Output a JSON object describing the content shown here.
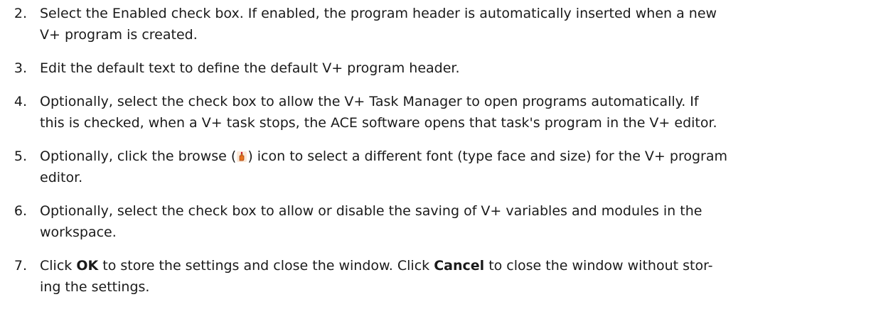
{
  "steps": [
    {
      "num": "2.",
      "line1": "Select the Enabled check box. If enabled, the program header is automatically inserted when a new",
      "line2": "V+ program is created."
    },
    {
      "num": "3.",
      "line1": "Edit the default text to define the default V+ program header."
    },
    {
      "num": "4.",
      "line1": "Optionally, select the check box to allow the V+ Task Manager to open programs automatically. If",
      "line2": "this is checked, when a V+ task stops, the ACE software opens that task's program in the V+ editor."
    },
    {
      "num": "5.",
      "line1_a": "Optionally, click the browse (",
      "line1_b": ") icon to select a different font (type face and size) for the V+ program",
      "line2": "editor.",
      "icon": "browse-hand-icon"
    },
    {
      "num": "6.",
      "line1": "Optionally, select the check box to allow or disable the saving of V+ variables and modules in the",
      "line2": "workspace."
    },
    {
      "num": "7.",
      "line1_a": "Click ",
      "ok": "OK",
      "line1_b": " to store the settings and close the window. Click ",
      "cancel": "Cancel",
      "line1_c": " to close the window without stor-",
      "line2": "ing the settings."
    }
  ]
}
